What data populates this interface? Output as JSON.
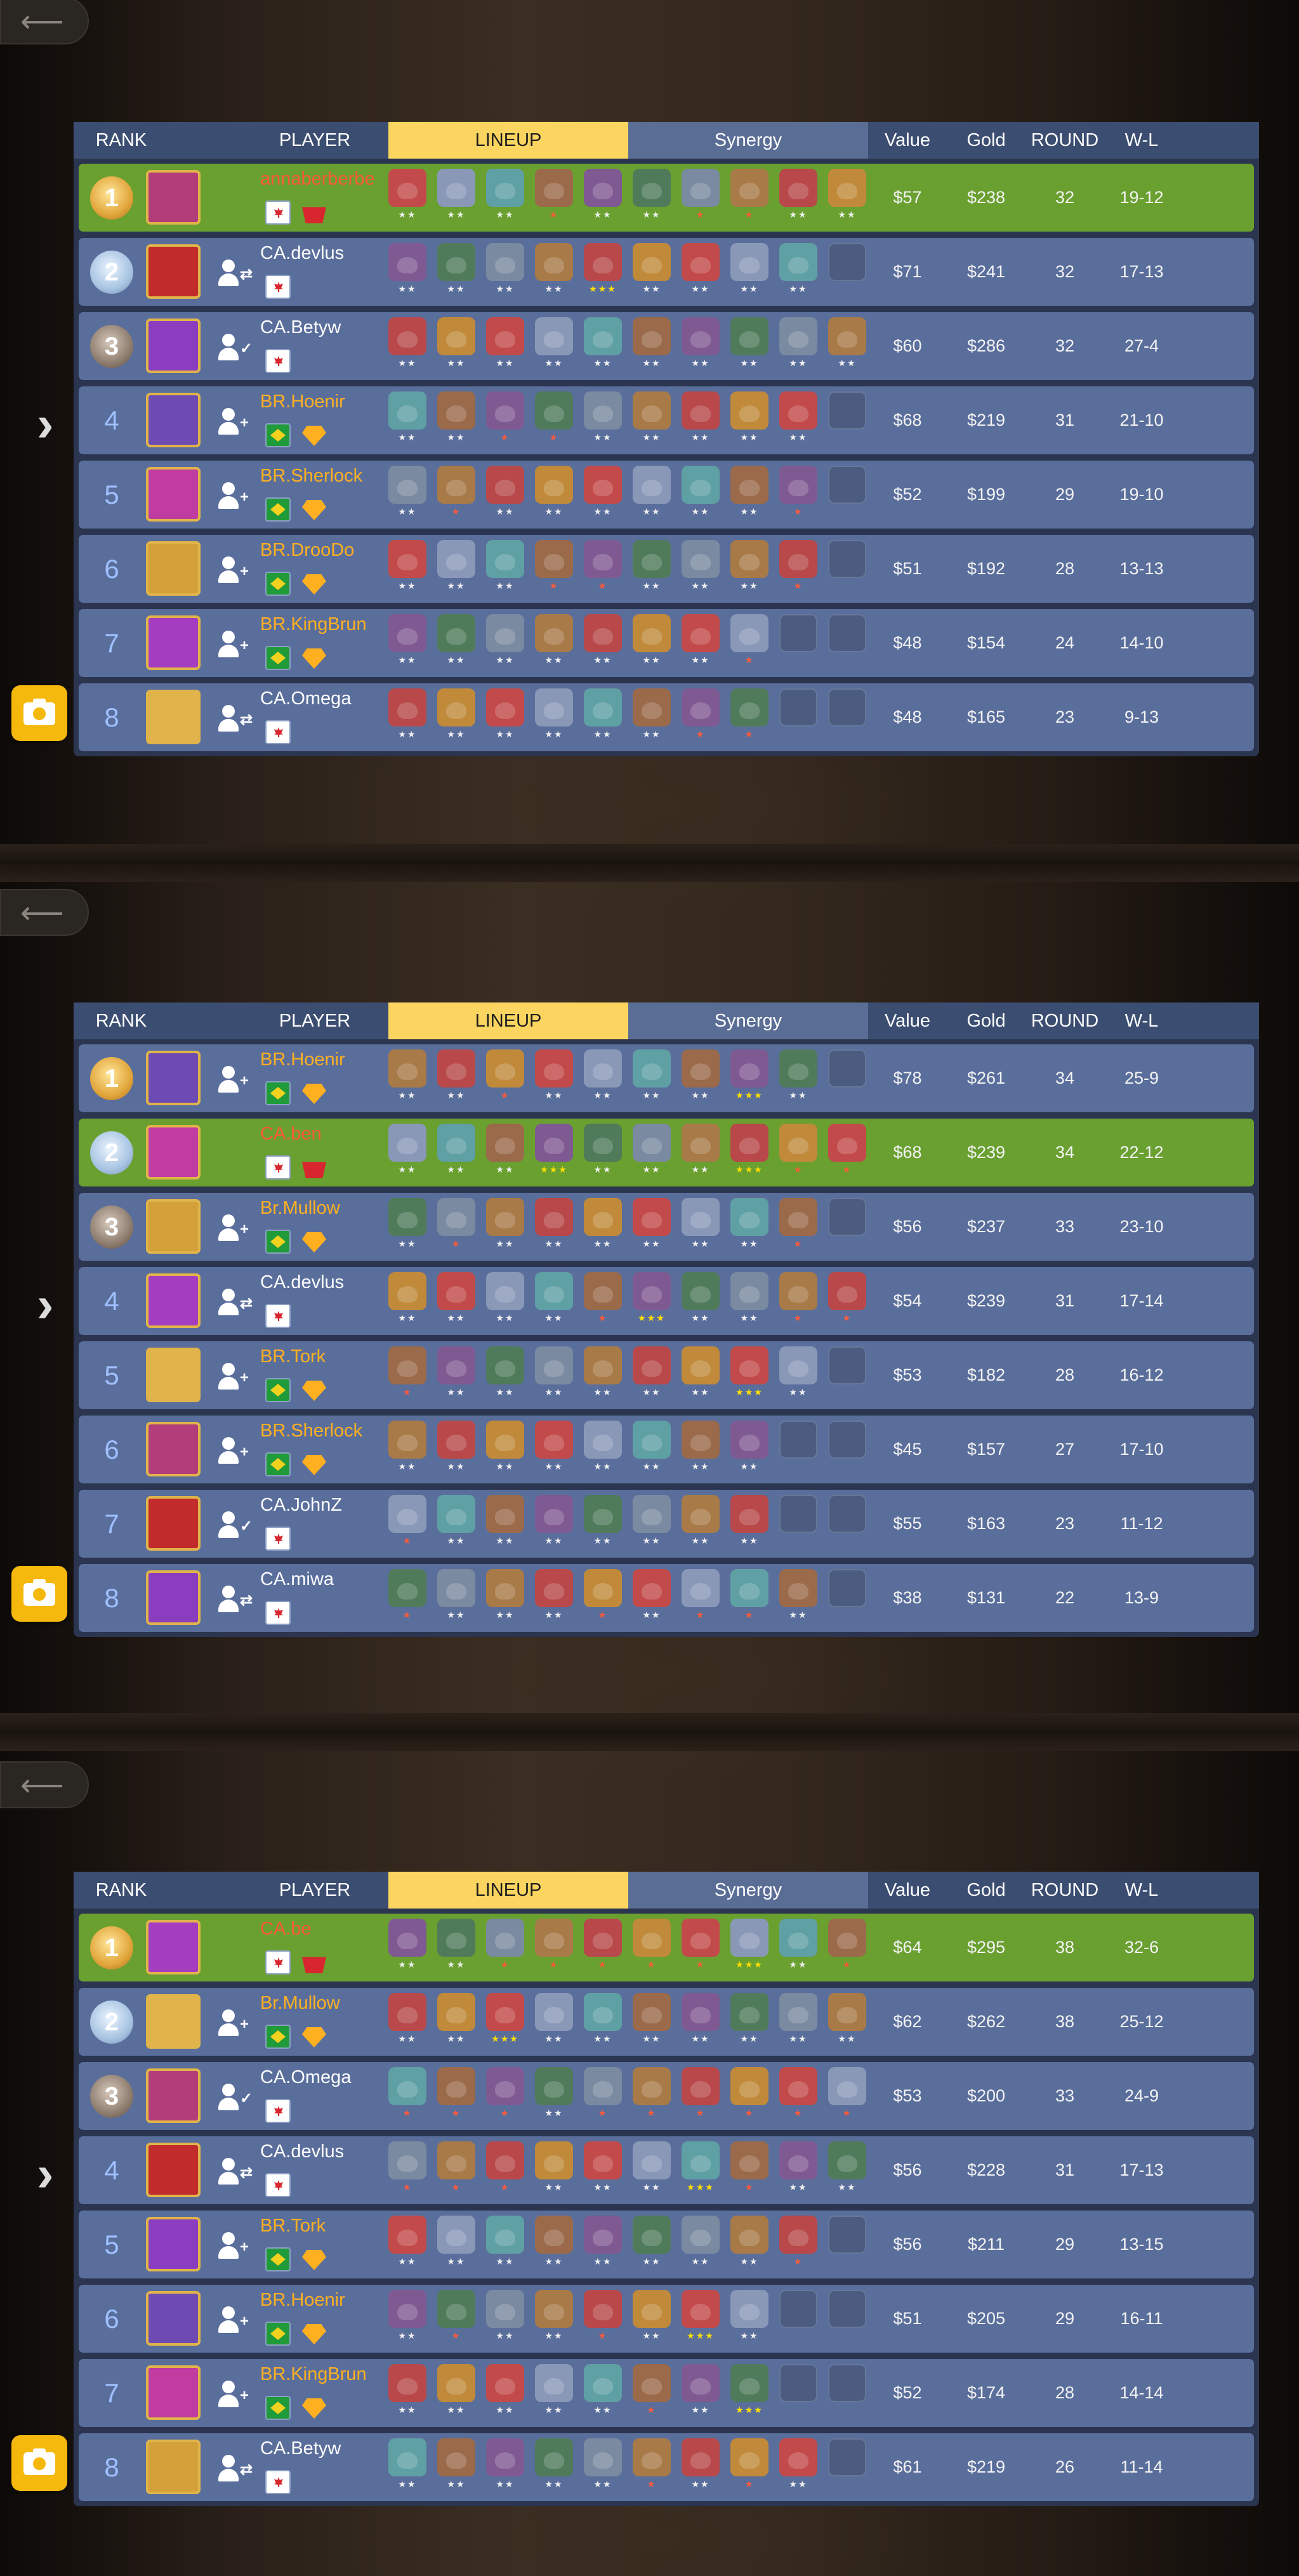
{
  "headers": {
    "rank": "RANK",
    "player": "PLAYER",
    "lineup": "LINEUP",
    "synergy": "Synergy",
    "value": "Value",
    "gold": "Gold",
    "round": "ROUND",
    "wl": "W-L"
  },
  "icons": {
    "back": "back-arrow-icon",
    "expand": "chevron-right-icon",
    "camera": "camera-icon",
    "friend": "add-friend-icon",
    "flag": "country-flag-icon",
    "rank_badge": "rank-gem-icon"
  },
  "colors": {
    "header_bg": "#3b4d71",
    "lineup_tab": "#fbd560",
    "row": "#5a6e9c",
    "row_self": "#69a030",
    "br_name": "#ffb020",
    "star_gold": "#ffe000",
    "star_red": "#ff5a3a"
  },
  "boards": [
    {
      "players": [
        {
          "rank": "1",
          "name": "annaberberbe",
          "self": true,
          "country": "CA",
          "value": "$57",
          "gold": "$238",
          "round": "32",
          "wl": "19-12",
          "units": [
            "2",
            "2",
            "2",
            "1",
            "2",
            "2",
            "1",
            "1",
            "2",
            "2"
          ]
        },
        {
          "rank": "2",
          "name": "CA.devlus",
          "country": "CA",
          "value": "$71",
          "gold": "$241",
          "round": "32",
          "wl": "17-13",
          "units": [
            "2",
            "2",
            "2",
            "2",
            "3",
            "2",
            "2",
            "2",
            "2",
            ""
          ]
        },
        {
          "rank": "3",
          "name": "CA.Betyw",
          "country": "CA",
          "value": "$60",
          "gold": "$286",
          "round": "32",
          "wl": "27-4",
          "units": [
            "2",
            "2",
            "2",
            "2",
            "2",
            "2",
            "2",
            "2",
            "2",
            "2"
          ]
        },
        {
          "rank": "4",
          "name": "BR.Hoenir",
          "country": "BR",
          "value": "$68",
          "gold": "$219",
          "round": "31",
          "wl": "21-10",
          "units": [
            "2",
            "2",
            "1",
            "1",
            "2",
            "2",
            "2",
            "2",
            "2",
            ""
          ]
        },
        {
          "rank": "5",
          "name": "BR.Sherlock",
          "country": "BR",
          "value": "$52",
          "gold": "$199",
          "round": "29",
          "wl": "19-10",
          "units": [
            "2",
            "1",
            "2",
            "2",
            "2",
            "2",
            "2",
            "2",
            "1",
            ""
          ]
        },
        {
          "rank": "6",
          "name": "BR.DrooDo",
          "country": "BR",
          "value": "$51",
          "gold": "$192",
          "round": "28",
          "wl": "13-13",
          "units": [
            "2",
            "2",
            "2",
            "1",
            "1",
            "2",
            "2",
            "2",
            "1",
            ""
          ]
        },
        {
          "rank": "7",
          "name": "BR.KingBrun",
          "country": "BR",
          "value": "$48",
          "gold": "$154",
          "round": "24",
          "wl": "14-10",
          "units": [
            "2",
            "2",
            "2",
            "2",
            "2",
            "2",
            "2",
            "1",
            "",
            ""
          ]
        },
        {
          "rank": "8",
          "name": "CA.Omega",
          "country": "CA",
          "value": "$48",
          "gold": "$165",
          "round": "23",
          "wl": "9-13",
          "units": [
            "2",
            "2",
            "2",
            "2",
            "2",
            "2",
            "1",
            "1",
            "",
            ""
          ]
        }
      ]
    },
    {
      "players": [
        {
          "rank": "1",
          "name": "BR.Hoenir",
          "country": "BR",
          "value": "$78",
          "gold": "$261",
          "round": "34",
          "wl": "25-9",
          "units": [
            "2",
            "2",
            "1",
            "2",
            "2",
            "2",
            "2",
            "3",
            "2",
            ""
          ]
        },
        {
          "rank": "2",
          "name": "CA.ben",
          "self": true,
          "country": "CA",
          "value": "$68",
          "gold": "$239",
          "round": "34",
          "wl": "22-12",
          "units": [
            "2",
            "2",
            "2",
            "3",
            "2",
            "2",
            "2",
            "3",
            "1",
            "1"
          ]
        },
        {
          "rank": "3",
          "name": "Br.Mullow",
          "country": "BR",
          "value": "$56",
          "gold": "$237",
          "round": "33",
          "wl": "23-10",
          "units": [
            "2",
            "1",
            "2",
            "2",
            "2",
            "2",
            "2",
            "2",
            "1",
            ""
          ]
        },
        {
          "rank": "4",
          "name": "CA.devlus",
          "country": "CA",
          "value": "$54",
          "gold": "$239",
          "round": "31",
          "wl": "17-14",
          "units": [
            "2",
            "2",
            "2",
            "2",
            "1",
            "3",
            "2",
            "2",
            "1",
            "1"
          ]
        },
        {
          "rank": "5",
          "name": "BR.Tork",
          "country": "BR",
          "value": "$53",
          "gold": "$182",
          "round": "28",
          "wl": "16-12",
          "units": [
            "1",
            "2",
            "2",
            "2",
            "2",
            "2",
            "2",
            "3",
            "2",
            ""
          ]
        },
        {
          "rank": "6",
          "name": "BR.Sherlock",
          "country": "BR",
          "value": "$45",
          "gold": "$157",
          "round": "27",
          "wl": "17-10",
          "units": [
            "2",
            "2",
            "2",
            "2",
            "2",
            "2",
            "2",
            "2",
            "",
            ""
          ]
        },
        {
          "rank": "7",
          "name": "CA.JohnZ",
          "country": "CA",
          "value": "$55",
          "gold": "$163",
          "round": "23",
          "wl": "11-12",
          "units": [
            "1",
            "2",
            "2",
            "2",
            "2",
            "2",
            "2",
            "2",
            "",
            ""
          ]
        },
        {
          "rank": "8",
          "name": "CA.miwa",
          "country": "CA",
          "value": "$38",
          "gold": "$131",
          "round": "22",
          "wl": "13-9",
          "units": [
            "1",
            "2",
            "2",
            "2",
            "1",
            "2",
            "1",
            "1",
            "2",
            ""
          ]
        }
      ]
    },
    {
      "players": [
        {
          "rank": "1",
          "name": "CA.be",
          "self": true,
          "country": "CA",
          "value": "$64",
          "gold": "$295",
          "round": "38",
          "wl": "32-6",
          "units": [
            "2",
            "2",
            "1",
            "1",
            "1",
            "1",
            "1",
            "3",
            "2",
            "1"
          ]
        },
        {
          "rank": "2",
          "name": "Br.Mullow",
          "country": "BR",
          "value": "$62",
          "gold": "$262",
          "round": "38",
          "wl": "25-12",
          "units": [
            "2",
            "2",
            "3",
            "2",
            "2",
            "2",
            "2",
            "2",
            "2",
            "2"
          ]
        },
        {
          "rank": "3",
          "name": "CA.Omega",
          "country": "CA",
          "value": "$53",
          "gold": "$200",
          "round": "33",
          "wl": "24-9",
          "units": [
            "1",
            "1",
            "1",
            "2",
            "1",
            "1",
            "1",
            "1",
            "1",
            "1"
          ]
        },
        {
          "rank": "4",
          "name": "CA.devlus",
          "country": "CA",
          "value": "$56",
          "gold": "$228",
          "round": "31",
          "wl": "17-13",
          "units": [
            "1",
            "1",
            "1",
            "2",
            "2",
            "2",
            "3",
            "1",
            "2",
            "2"
          ]
        },
        {
          "rank": "5",
          "name": "BR.Tork",
          "country": "BR",
          "value": "$56",
          "gold": "$211",
          "round": "29",
          "wl": "13-15",
          "units": [
            "2",
            "2",
            "2",
            "2",
            "2",
            "2",
            "2",
            "2",
            "1",
            ""
          ]
        },
        {
          "rank": "6",
          "name": "BR.Hoenir",
          "country": "BR",
          "value": "$51",
          "gold": "$205",
          "round": "29",
          "wl": "16-11",
          "units": [
            "2",
            "1",
            "2",
            "2",
            "1",
            "2",
            "3",
            "2",
            "",
            ""
          ]
        },
        {
          "rank": "7",
          "name": "BR.KingBrun",
          "country": "BR",
          "value": "$52",
          "gold": "$174",
          "round": "28",
          "wl": "14-14",
          "units": [
            "2",
            "2",
            "2",
            "2",
            "2",
            "1",
            "2",
            "3",
            "",
            ""
          ]
        },
        {
          "rank": "8",
          "name": "CA.Betyw",
          "country": "CA",
          "value": "$61",
          "gold": "$219",
          "round": "26",
          "wl": "11-14",
          "units": [
            "2",
            "2",
            "2",
            "2",
            "2",
            "1",
            "2",
            "1",
            "2",
            ""
          ]
        }
      ]
    }
  ]
}
